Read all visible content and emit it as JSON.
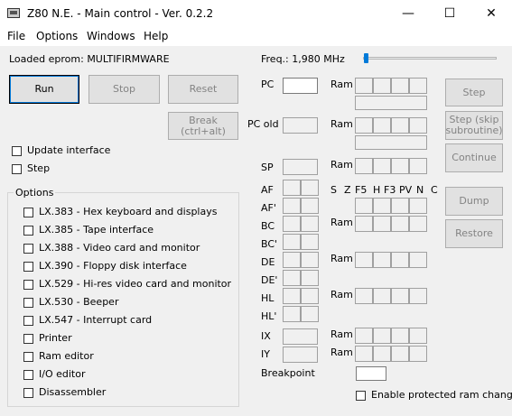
{
  "window": {
    "title": "Z80 N.E. - Main control - Ver. 0.2.2",
    "minimize": "—",
    "maximize": "☐",
    "close": "✕"
  },
  "menu": [
    "File",
    "Options",
    "Windows",
    "Help"
  ],
  "loaded_eprom": "Loaded eprom: MULTIFIRMWARE",
  "freq_label": "Freq.: 1,980 MHz",
  "freq_slider": {
    "value_fraction": 0.0
  },
  "buttons": {
    "run": "Run",
    "stop": "Stop",
    "reset": "Reset",
    "break": "Break (ctrl+alt)",
    "step": "Step",
    "step_skip": "Step (skip subroutine)",
    "continue": "Continue",
    "dump": "Dump",
    "restore": "Restore"
  },
  "checks": {
    "update_interface": "Update interface",
    "step": "Step"
  },
  "options_title": "Options",
  "options": [
    "LX.383 - Hex keyboard and displays",
    "LX.385 - Tape interface",
    "LX.388 - Video card and monitor",
    "LX.390 - Floppy disk interface",
    "LX.529 - Hi-res video card and monitor",
    "LX.530 - Beeper",
    "LX.547 - Interrupt card",
    "Printer",
    "Ram editor",
    "I/O editor",
    "Disassembler"
  ],
  "registers": {
    "pc": "PC",
    "pc_old": "PC old",
    "sp": "SP",
    "af": "AF",
    "af2": "AF'",
    "bc": "BC",
    "bc2": "BC'",
    "de": "DE",
    "de2": "DE'",
    "hl": "HL",
    "hl2": "HL'",
    "ix": "IX",
    "iy": "IY",
    "breakpoint": "Breakpoint"
  },
  "ram_label": "Ram",
  "flags": [
    "S",
    "Z",
    "F5",
    "H",
    "F3",
    "PV",
    "N",
    "C"
  ],
  "enable_protected": "Enable protected ram change"
}
